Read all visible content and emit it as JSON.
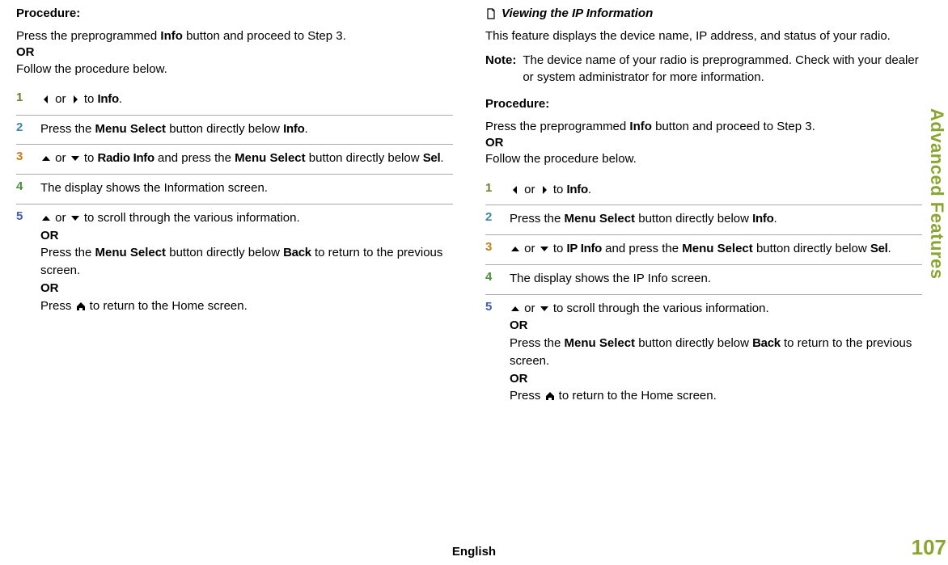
{
  "sidebar": "Advanced Features",
  "pageNumber": "107",
  "language": "English",
  "left": {
    "procedureTitle": "Procedure:",
    "intro_part1": "Press the preprogrammed ",
    "intro_info": "Info",
    "intro_part2": " button and proceed to Step 3.",
    "intro_or": "OR",
    "intro_follow": "Follow the procedure below.",
    "step1_or": " or ",
    "step1_to": " to ",
    "step1_target": "Info",
    "step1_period": ".",
    "step2_a": "Press the ",
    "step2_b": "Menu Select",
    "step2_c": " button directly below ",
    "step2_d": "Info",
    "step2_e": ".",
    "step3_or": " or ",
    "step3_to": " to ",
    "step3_target": "Radio Info",
    "step3_mid": " and press the ",
    "step3_ms": "Menu Select",
    "step3_tail": " button directly below ",
    "step3_sel": "Sel",
    "step3_period": ".",
    "step4": "The display shows the Information screen.",
    "step5_or": " or ",
    "step5_scroll": " to scroll through the various information.",
    "step5_OR1": "OR",
    "step5_press1a": "Press the ",
    "step5_press1b": "Menu Select",
    "step5_press1c": " button directly below ",
    "step5_back": "Back",
    "step5_press1d": " to return to the previous screen.",
    "step5_OR2": "OR",
    "step5_press2a": "Press ",
    "step5_press2b": " to return to the Home screen."
  },
  "right": {
    "heading": "Viewing the IP Information",
    "intro": "This feature displays the device name, IP address, and status of your radio.",
    "noteLabel": "Note:",
    "noteBody": "The device name of your radio is preprogrammed. Check with your dealer or system administrator for more information.",
    "procedureTitle": "Procedure:",
    "intro_part1": "Press the preprogrammed ",
    "intro_info": "Info",
    "intro_part2": " button and proceed to Step 3.",
    "intro_or": "OR",
    "intro_follow": "Follow the procedure below.",
    "step1_or": " or ",
    "step1_to": " to ",
    "step1_target": "Info",
    "step1_period": ".",
    "step2_a": "Press the ",
    "step2_b": "Menu Select",
    "step2_c": " button directly below ",
    "step2_d": "Info",
    "step2_e": ".",
    "step3_or": " or ",
    "step3_to": " to ",
    "step3_target": "IP Info",
    "step3_mid": " and press the ",
    "step3_ms": "Menu Select",
    "step3_tail": " button directly below ",
    "step3_sel": "Sel",
    "step3_period": ".",
    "step4": "The display shows the IP Info screen.",
    "step5_or": " or ",
    "step5_scroll": " to scroll through the various information.",
    "step5_OR1": "OR",
    "step5_press1a": "Press the ",
    "step5_press1b": "Menu Select",
    "step5_press1c": " button directly below ",
    "step5_back": "Back",
    "step5_press1d": " to return to the previous screen.",
    "step5_OR2": "OR",
    "step5_press2a": "Press ",
    "step5_press2b": " to return to the Home screen."
  }
}
